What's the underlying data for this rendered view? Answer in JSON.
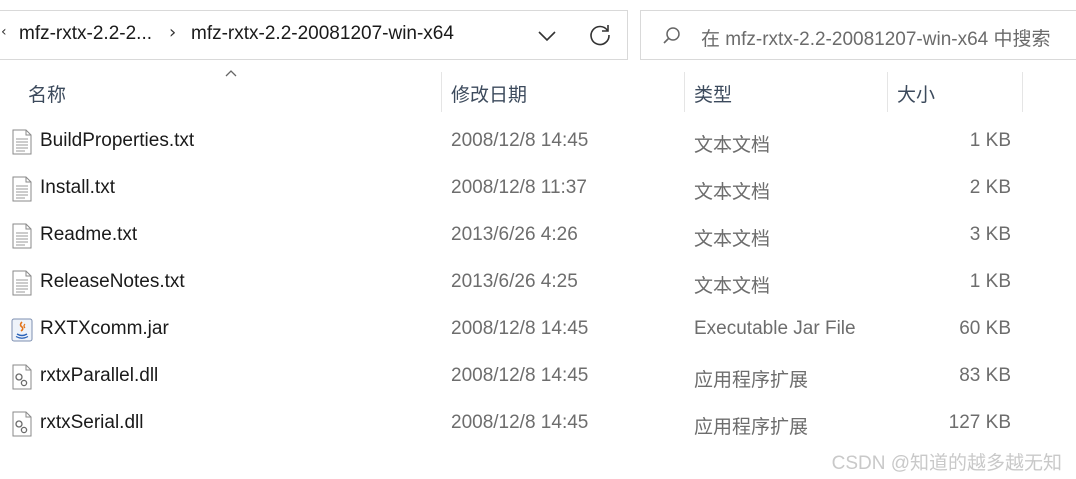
{
  "address_bar": {
    "breadcrumbs": [
      "mfz-rxtx-2.2-2...",
      "mfz-rxtx-2.2-20081207-win-x64"
    ],
    "dropdown_icon": "chevron-down-icon",
    "refresh_icon": "refresh-icon"
  },
  "search": {
    "placeholder": "在 mfz-rxtx-2.2-20081207-win-x64 中搜索",
    "icon": "search-icon"
  },
  "columns": {
    "name": "名称",
    "date": "修改日期",
    "type": "类型",
    "size": "大小",
    "sort_icon": "sort-up-icon"
  },
  "files": [
    {
      "name": "BuildProperties.txt",
      "date": "2008/12/8 14:45",
      "type": "文本文档",
      "size": "1 KB",
      "icon": "text-file-icon"
    },
    {
      "name": "Install.txt",
      "date": "2008/12/8 11:37",
      "type": "文本文档",
      "size": "2 KB",
      "icon": "text-file-icon"
    },
    {
      "name": "Readme.txt",
      "date": "2013/6/26 4:26",
      "type": "文本文档",
      "size": "3 KB",
      "icon": "text-file-icon"
    },
    {
      "name": "ReleaseNotes.txt",
      "date": "2013/6/26 4:25",
      "type": "文本文档",
      "size": "1 KB",
      "icon": "text-file-icon"
    },
    {
      "name": "RXTXcomm.jar",
      "date": "2008/12/8 14:45",
      "type": "Executable Jar File",
      "size": "60 KB",
      "icon": "java-jar-icon"
    },
    {
      "name": "rxtxParallel.dll",
      "date": "2008/12/8 14:45",
      "type": "应用程序扩展",
      "size": "83 KB",
      "icon": "dll-file-icon"
    },
    {
      "name": "rxtxSerial.dll",
      "date": "2008/12/8 14:45",
      "type": "应用程序扩展",
      "size": "127 KB",
      "icon": "dll-file-icon"
    }
  ],
  "watermark": "CSDN @知道的越多越无知"
}
